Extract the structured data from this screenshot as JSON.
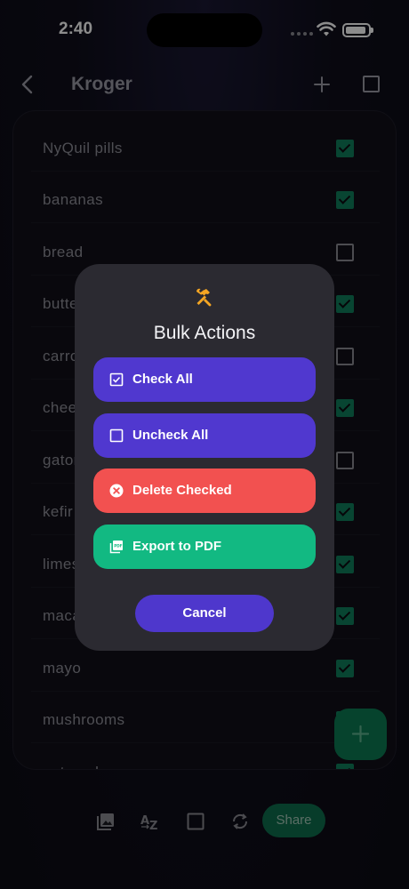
{
  "status_bar": {
    "time": "2:40"
  },
  "nav": {
    "title": "Kroger"
  },
  "list": {
    "items": [
      {
        "label": "NyQuil pills",
        "checked": true
      },
      {
        "label": "bananas",
        "checked": true
      },
      {
        "label": "bread",
        "checked": false
      },
      {
        "label": "butter",
        "checked": true
      },
      {
        "label": "carrots",
        "checked": false
      },
      {
        "label": "cheese",
        "checked": true
      },
      {
        "label": "gatorade",
        "checked": false
      },
      {
        "label": "kefir",
        "checked": true
      },
      {
        "label": "limes",
        "checked": true
      },
      {
        "label": "macaroni",
        "checked": true
      },
      {
        "label": "mayo",
        "checked": true
      },
      {
        "label": "mushrooms",
        "checked": true
      },
      {
        "label": "oatmeal",
        "checked": true
      }
    ]
  },
  "bottom_bar": {
    "share_label": "Share"
  },
  "modal": {
    "title": "Bulk Actions",
    "check_all": "Check All",
    "uncheck_all": "Uncheck All",
    "delete_checked": "Delete Checked",
    "export_pdf": "Export to PDF",
    "cancel": "Cancel"
  },
  "colors": {
    "primary": "#5038cf",
    "danger": "#f25150",
    "success": "#12b982",
    "accent_icon": "#f5a623",
    "check_green": "#0f7f5b"
  },
  "icons": {
    "back": "chevron-left-icon",
    "add": "plus-icon",
    "select": "checkbox-outline-icon",
    "tools": "hammer-wrench-icon",
    "check_all": "checkbox-marked-icon",
    "uncheck_all": "checkbox-blank-icon",
    "delete": "close-circle-icon",
    "export": "pdf-file-icon",
    "image": "image-icon",
    "sort": "sort-az-icon",
    "select_bottom": "checkbox-outline-icon",
    "sync": "sync-icon"
  }
}
